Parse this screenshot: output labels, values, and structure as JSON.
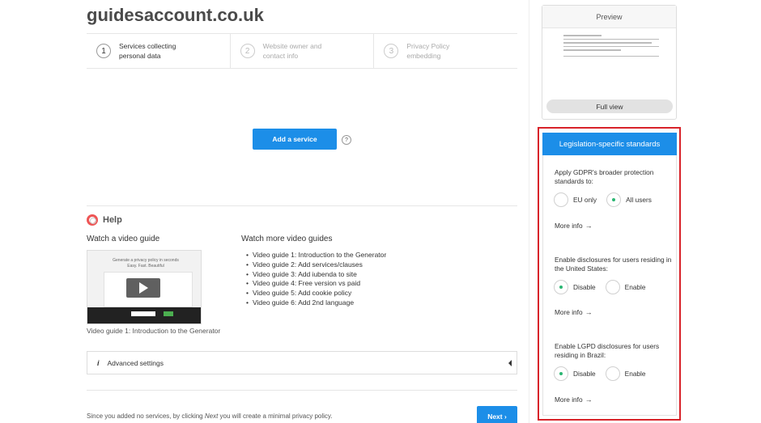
{
  "site_title": "guidesaccount.co.uk",
  "steps": [
    {
      "number": "1",
      "label": "Services collecting personal data"
    },
    {
      "number": "2",
      "label": "Website owner and contact info"
    },
    {
      "number": "3",
      "label": "Privacy Policy embedding"
    }
  ],
  "add_service_label": "Add a service",
  "help_q": "?",
  "help": {
    "title": "Help",
    "watch_title": "Watch a video guide",
    "video_caption": "Video guide 1: Introduction to the Generator",
    "thumb_text": "Generate a privacy policy in seconds Easy. Fast. Beautiful",
    "more_title": "Watch more video guides",
    "guides": [
      "Video guide 1: Introduction to the Generator",
      "Video guide 2: Add services/clauses",
      "Video guide 3: Add iubenda to site",
      "Video guide 4: Free version vs paid",
      "Video guide 5: Add cookie policy",
      "Video guide 6: Add 2nd language"
    ]
  },
  "advanced": {
    "icon": "i",
    "label": "Advanced settings"
  },
  "footer": {
    "note_prefix": "Since you added no services, by clicking ",
    "note_em": "Next",
    "note_suffix": " you will create a minimal privacy policy.",
    "next_label": "Next ›"
  },
  "preview": {
    "title": "Preview",
    "full_view_label": "Full view"
  },
  "legislation": {
    "title": "Legislation-specific standards",
    "gdpr": {
      "question": "Apply GDPR's broader protection standards to:",
      "options": [
        "EU only",
        "All users"
      ],
      "selected": 1
    },
    "us": {
      "question": "Enable disclosures for users residing in the United States:",
      "options": [
        "Disable",
        "Enable"
      ],
      "selected": 0
    },
    "lgpd": {
      "question": "Enable LGPD disclosures for users residing in Brazil:",
      "options": [
        "Disable",
        "Enable"
      ],
      "selected": 0
    },
    "more_info_label": "More info",
    "arrow": "→"
  }
}
